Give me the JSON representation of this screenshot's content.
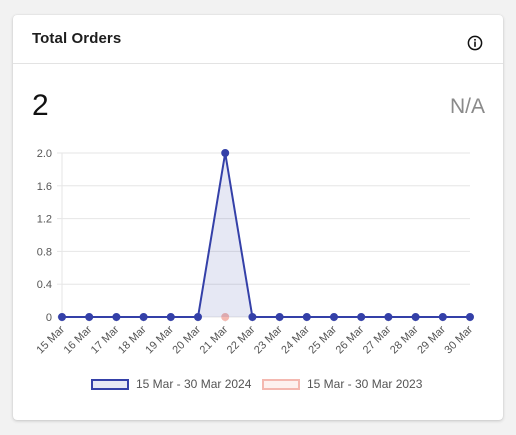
{
  "card": {
    "title": "Total Orders",
    "value": "2",
    "comparison": "N/A",
    "info_icon": "info-circle-icon"
  },
  "colors": {
    "current": "#3440a8",
    "current_fill": "rgba(52,64,168,0.12)",
    "previous": "#f4b8b0",
    "grid": "#e6e6e6",
    "tick_text": "#555555"
  },
  "chart_data": {
    "type": "area",
    "x": [
      "15 Mar",
      "16 Mar",
      "17 Mar",
      "18 Mar",
      "19 Mar",
      "20 Mar",
      "21 Mar",
      "22 Mar",
      "23 Mar",
      "24 Mar",
      "25 Mar",
      "26 Mar",
      "27 Mar",
      "28 Mar",
      "29 Mar",
      "30 Mar"
    ],
    "yticks": [
      "0",
      "0.4",
      "0.8",
      "1.2",
      "1.6",
      "2.0"
    ],
    "ylim": [
      0,
      2
    ],
    "grid": true,
    "legend_position": "bottom",
    "series": [
      {
        "name": "15 Mar - 30 Mar 2024",
        "values": [
          0,
          0,
          0,
          0,
          0,
          0,
          2,
          0,
          0,
          0,
          0,
          0,
          0,
          0,
          0,
          0
        ]
      },
      {
        "name": "15 Mar - 30 Mar 2023",
        "values": [
          null,
          null,
          null,
          null,
          null,
          null,
          0,
          null,
          null,
          null,
          null,
          null,
          null,
          null,
          null,
          null
        ]
      }
    ]
  }
}
